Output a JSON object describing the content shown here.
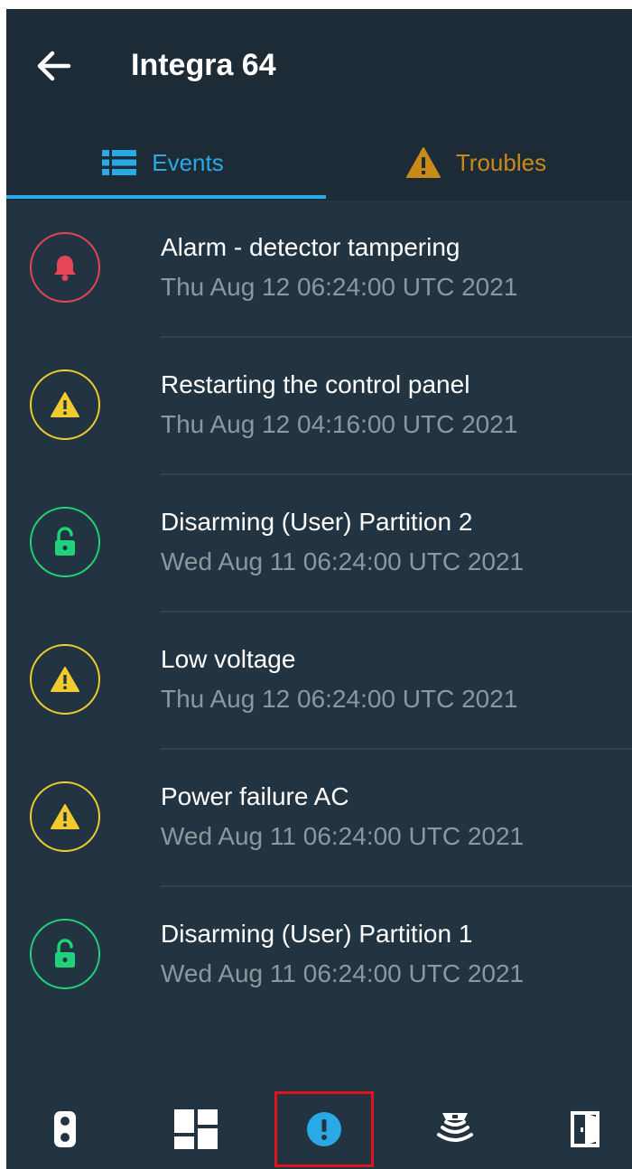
{
  "header": {
    "title": "Integra 64",
    "back_icon": "arrow-left-icon"
  },
  "tabs": [
    {
      "label": "Events",
      "icon": "list-icon",
      "active": true,
      "color": "#29a9e6"
    },
    {
      "label": "Troubles",
      "icon": "warning-triangle-icon",
      "active": false,
      "color": "#c98a17"
    }
  ],
  "events": [
    {
      "title": "Alarm - detector tampering",
      "time": "Thu Aug 12 06:24:00 UTC 2021",
      "type": "alarm",
      "icon": "bell-icon",
      "color": "#e54557"
    },
    {
      "title": "Restarting the control panel",
      "time": "Thu Aug 12 04:16:00 UTC 2021",
      "type": "trouble",
      "icon": "warning-icon",
      "color": "#f2cc2e"
    },
    {
      "title": "Disarming (User) Partition 2",
      "time": "Wed Aug 11 06:24:00 UTC 2021",
      "type": "disarm",
      "icon": "unlock-icon",
      "color": "#1fd27a"
    },
    {
      "title": "Low voltage",
      "time": "Thu Aug 12 06:24:00 UTC 2021",
      "type": "trouble",
      "icon": "warning-icon",
      "color": "#f2cc2e"
    },
    {
      "title": "Power failure AC",
      "time": "Wed Aug 11 06:24:00 UTC 2021",
      "type": "trouble",
      "icon": "warning-icon",
      "color": "#f2cc2e"
    },
    {
      "title": "Disarming (User) Partition 1",
      "time": "Wed Aug 11 06:24:00 UTC 2021",
      "type": "disarm",
      "icon": "unlock-icon",
      "color": "#1fd27a"
    }
  ],
  "bottom_nav": [
    {
      "name": "nav-device",
      "icon": "remote-device-icon",
      "active": false
    },
    {
      "name": "nav-dashboard",
      "icon": "dashboard-icon",
      "active": false
    },
    {
      "name": "nav-events",
      "icon": "alert-circle-icon",
      "active": true
    },
    {
      "name": "nav-detectors",
      "icon": "detector-icon",
      "active": false
    },
    {
      "name": "nav-outputs",
      "icon": "door-icon",
      "active": false
    }
  ]
}
